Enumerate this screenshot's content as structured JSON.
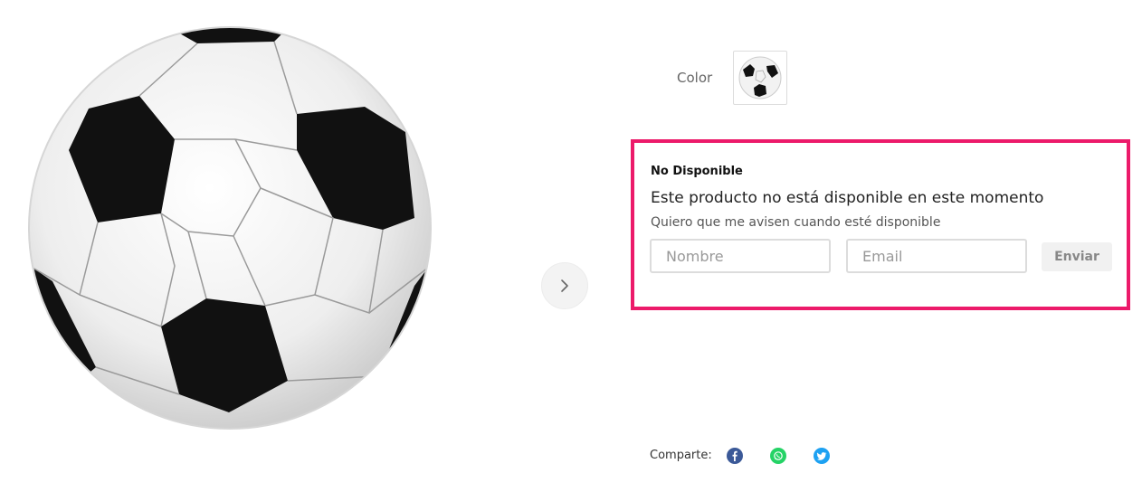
{
  "product": {
    "image_icon": "soccer-ball-icon",
    "next_icon": "chevron-right-icon"
  },
  "color": {
    "label": "Color",
    "swatch_icon": "soccer-ball-icon"
  },
  "notify": {
    "title": "No Disponible",
    "message": "Este producto no está disponible en este momento",
    "subtitle": "Quiero que me avisen cuando esté disponible",
    "name_placeholder": "Nombre",
    "email_placeholder": "Email",
    "send_label": "Enviar",
    "border_color": "#ec1a6a"
  },
  "share": {
    "label": "Comparte:",
    "items": [
      {
        "name": "facebook",
        "icon": "facebook-icon",
        "color": "#3b5998"
      },
      {
        "name": "whatsapp",
        "icon": "whatsapp-icon",
        "color": "#25d366"
      },
      {
        "name": "twitter",
        "icon": "twitter-icon",
        "color": "#1da1f2"
      }
    ]
  }
}
